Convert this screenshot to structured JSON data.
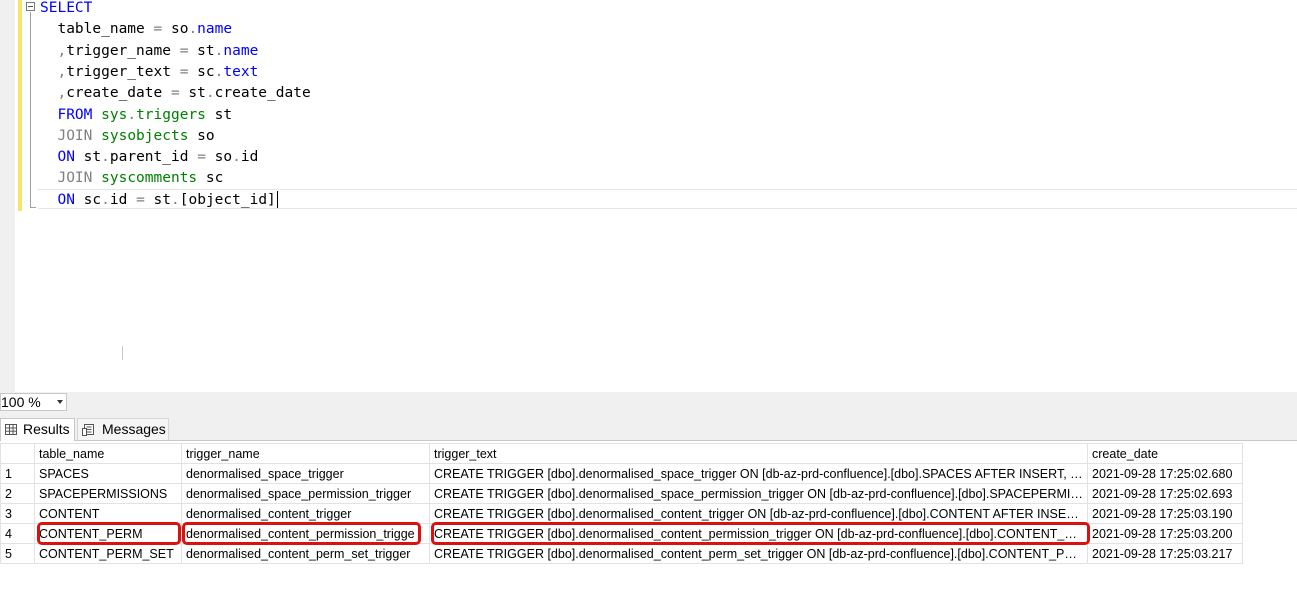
{
  "editor": {
    "lines": [
      [
        [
          "kw",
          "SELECT"
        ]
      ],
      [
        [
          "",
          "  table_name "
        ],
        [
          "gy",
          "="
        ],
        [
          "",
          " so"
        ],
        [
          "gy",
          "."
        ],
        [
          "kw",
          "name"
        ]
      ],
      [
        [
          "gy",
          "  ,"
        ],
        [
          "",
          "trigger_name "
        ],
        [
          "gy",
          "="
        ],
        [
          "",
          " st"
        ],
        [
          "gy",
          "."
        ],
        [
          "kw",
          "name"
        ]
      ],
      [
        [
          "gy",
          "  ,"
        ],
        [
          "",
          "trigger_text "
        ],
        [
          "gy",
          "="
        ],
        [
          "",
          " sc"
        ],
        [
          "gy",
          "."
        ],
        [
          "kw",
          "text"
        ]
      ],
      [
        [
          "gy",
          "  ,"
        ],
        [
          "",
          "create_date "
        ],
        [
          "gy",
          "="
        ],
        [
          "",
          " st"
        ],
        [
          "gy",
          "."
        ],
        [
          "",
          "create_date"
        ]
      ],
      [
        [
          "",
          "  "
        ],
        [
          "kw",
          "FROM"
        ],
        [
          "",
          " "
        ],
        [
          "ob",
          "sys"
        ],
        [
          "gy",
          "."
        ],
        [
          "ob",
          "triggers"
        ],
        [
          "",
          " st"
        ]
      ],
      [
        [
          "",
          "  "
        ],
        [
          "gy",
          "JOIN"
        ],
        [
          "",
          " "
        ],
        [
          "ob",
          "sysobjects"
        ],
        [
          "",
          " so"
        ]
      ],
      [
        [
          "",
          "  "
        ],
        [
          "kw",
          "ON"
        ],
        [
          "",
          " st"
        ],
        [
          "gy",
          "."
        ],
        [
          "",
          "parent_id "
        ],
        [
          "gy",
          "="
        ],
        [
          "",
          " so"
        ],
        [
          "gy",
          "."
        ],
        [
          "",
          "id"
        ]
      ],
      [
        [
          "",
          "  "
        ],
        [
          "gy",
          "JOIN"
        ],
        [
          "",
          " "
        ],
        [
          "ob",
          "syscomments"
        ],
        [
          "",
          " sc"
        ]
      ],
      [
        [
          "",
          "  "
        ],
        [
          "kw",
          "ON"
        ],
        [
          "",
          " sc"
        ],
        [
          "gy",
          "."
        ],
        [
          "",
          "id "
        ],
        [
          "gy",
          "="
        ],
        [
          "",
          " st"
        ],
        [
          "gy",
          "."
        ],
        [
          "",
          "[object_id]"
        ]
      ]
    ]
  },
  "zoom": {
    "value": "100 %"
  },
  "tabs": {
    "results": "Results",
    "messages": "Messages"
  },
  "grid": {
    "columns": [
      "table_name",
      "trigger_name",
      "trigger_text",
      "create_date"
    ],
    "rows": [
      {
        "n": "1",
        "table_name": "SPACES",
        "trigger_name": "denormalised_space_trigger",
        "trigger_text": "CREATE TRIGGER [dbo].denormalised_space_trigger ON [db-az-prd-confluence].[dbo].SPACES AFTER INSERT, UP...",
        "create_date": "2021-09-28 17:25:02.680"
      },
      {
        "n": "2",
        "table_name": "SPACEPERMISSIONS",
        "trigger_name": "denormalised_space_permission_trigger",
        "trigger_text": "CREATE TRIGGER [dbo].denormalised_space_permission_trigger ON [db-az-prd-confluence].[dbo].SPACEPERMIS...",
        "create_date": "2021-09-28 17:25:02.693"
      },
      {
        "n": "3",
        "table_name": "CONTENT",
        "trigger_name": "denormalised_content_trigger",
        "trigger_text": "CREATE TRIGGER [dbo].denormalised_content_trigger ON [db-az-prd-confluence].[dbo].CONTENT AFTER INSERT,...",
        "create_date": "2021-09-28 17:25:03.190"
      },
      {
        "n": "4",
        "table_name": "CONTENT_PERM",
        "trigger_name": "denormalised_content_permission_trigge",
        "trigger_text": "CREATE TRIGGER [dbo].denormalised_content_permission_trigger ON [db-az-prd-confluence].[dbo].CONTENT_PE...",
        "create_date": "2021-09-28 17:25:03.200"
      },
      {
        "n": "5",
        "table_name": "CONTENT_PERM_SET",
        "trigger_name": "denormalised_content_perm_set_trigger",
        "trigger_text": "CREATE TRIGGER [dbo].denormalised_content_perm_set_trigger ON [db-az-prd-confluence].[dbo].CONTENT_PER...",
        "create_date": "2021-09-28 17:25:03.217"
      }
    ]
  },
  "colors": {
    "highlight": "#dd1010",
    "keyword": "#0000ff",
    "object": "#008000",
    "operator": "#808080"
  }
}
